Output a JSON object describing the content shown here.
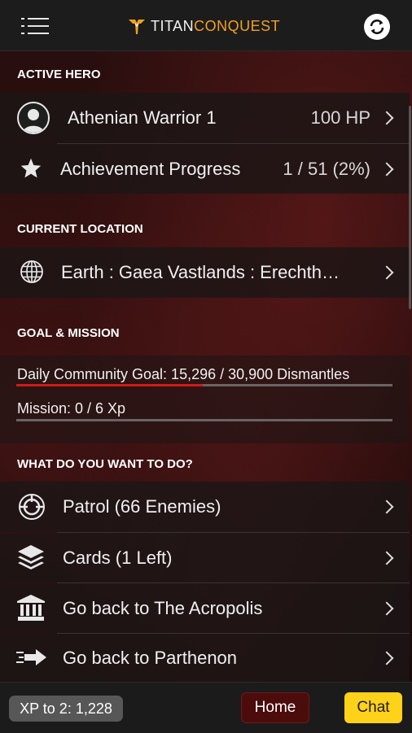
{
  "header": {
    "brand_part1": "TITAN",
    "brand_part2": "CONQUEST",
    "menu_icon": "hamburger-menu-icon",
    "refresh_icon": "refresh-icon",
    "brand_color": "#f0a020"
  },
  "active_hero": {
    "heading": "ACTIVE HERO",
    "hero_name": "Athenian Warrior 1",
    "hero_hp": "100 HP",
    "achievement_label": "Achievement Progress",
    "achievement_value": "1 / 51 (2%)"
  },
  "location": {
    "heading": "CURRENT LOCATION",
    "value": "Earth : Gaea Vastlands : Erechth…"
  },
  "goal": {
    "heading": "GOAL & MISSION",
    "daily_goal_text": "Daily Community Goal: 15,296 / 30,900 Dismantles",
    "daily_goal_progress": 0.495,
    "mission_text": "Mission: 0 / 6 Xp",
    "mission_progress": 0,
    "progress_color": "#d21a1a"
  },
  "actions": {
    "heading": "WHAT DO YOU WANT TO DO?",
    "items": [
      {
        "label": "Patrol (66 Enemies)",
        "icon": "target-icon"
      },
      {
        "label": "Cards (1 Left)",
        "icon": "layers-icon"
      },
      {
        "label": "Go back to The Acropolis",
        "icon": "temple-icon"
      },
      {
        "label": "Go back to Parthenon",
        "icon": "dash-arrow-icon"
      }
    ]
  },
  "footer": {
    "xp_label": "XP to 2: 1,228",
    "home_label": "Home",
    "chat_label": "Chat",
    "home_color": "#4c0c0c",
    "chat_color": "#ffd21a"
  }
}
